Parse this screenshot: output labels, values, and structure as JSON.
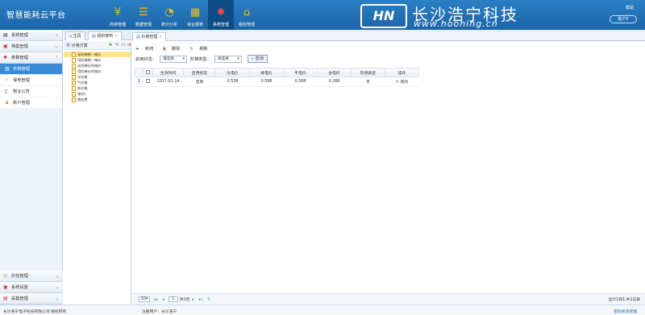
{
  "app": {
    "title": "智慧能耗云平台",
    "help": "帮助",
    "user": "客户5"
  },
  "nav": [
    {
      "label": "商用管理",
      "icon": "yen-icon"
    },
    {
      "label": "数据管理",
      "icon": "database-icon"
    },
    {
      "label": "统计分析",
      "icon": "pie-chart-icon"
    },
    {
      "label": "综合报表",
      "icon": "table-icon"
    },
    {
      "label": "系统管理",
      "icon": "gear-icon",
      "active": true
    },
    {
      "label": "租控管理",
      "icon": "home-icon"
    }
  ],
  "logo": {
    "mark": "HN",
    "cn": "长沙浩宁科技",
    "en": "www.hooning.cn"
  },
  "sidebar": {
    "header": "系统管理",
    "sections": [
      {
        "label": "档案管理"
      },
      {
        "label": "参数管理",
        "open": true
      }
    ],
    "items": [
      {
        "label": "价格管理",
        "active": true
      },
      {
        "label": "保电管理"
      },
      {
        "label": "物业公告"
      },
      {
        "label": "账户管理"
      }
    ],
    "bottom": [
      {
        "label": "抄控管理"
      },
      {
        "label": "系统设置"
      },
      {
        "label": "采集管理"
      }
    ]
  },
  "tabs": {
    "home": "主页",
    "org": "组织架构",
    "price": "价格管理"
  },
  "tree": {
    "title": "价格方案",
    "nodes": [
      "无阶梯统一电价",
      "用阶梯统一电价",
      "无阶梯分时电价",
      "用阶梯分时电价",
      "水价格",
      "气价格",
      "热价格",
      "电价1",
      "物业费"
    ]
  },
  "toolbar": {
    "add": "新增",
    "delete": "删除",
    "refresh": "刷新"
  },
  "filter": {
    "status_label": "启用状态：",
    "status_value": "请选择",
    "type_label": "阶梯类型：",
    "type_value": "请选择",
    "query": "查询"
  },
  "table": {
    "columns": [
      "生效时间",
      "启用状态",
      "尖电价",
      "峰电价",
      "平电价",
      "谷电价",
      "阶梯类型",
      "操作"
    ],
    "rows": [
      {
        "num": "1",
        "cells": [
          "2017-01-14",
          "启用",
          "0.538",
          "0.598",
          "0.568",
          "0.288",
          "无",
          "修改"
        ]
      }
    ]
  },
  "pager": {
    "size": "10",
    "page": "1",
    "of": "共1页",
    "info": "显示1到1,共1记录"
  },
  "footer": {
    "company": "长沙浩宁电子科技有限公司 版权所有",
    "reg": "注册用户：长沙浩宁",
    "pwd": "密码修改管理"
  }
}
